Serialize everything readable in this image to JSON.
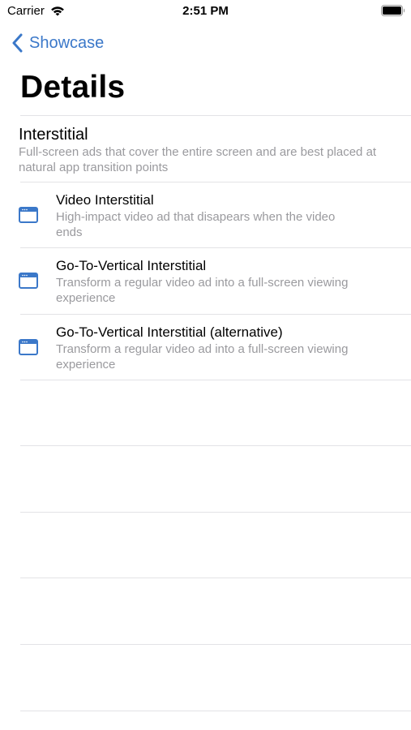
{
  "status_bar": {
    "carrier": "Carrier",
    "time": "2:51 PM",
    "wifi_icon": "wifi-icon",
    "battery_icon": "battery-icon"
  },
  "nav": {
    "back_label": "Showcase",
    "back_icon": "chevron-left-icon",
    "accent_color": "#3b78c9"
  },
  "page": {
    "title": "Details"
  },
  "section": {
    "title": "Interstitial",
    "description": "Full-screen ads that cover the entire screen and are best placed at natural app transition points"
  },
  "items": [
    {
      "title": "Video Interstitial",
      "description": "High-impact video ad that disapears when the video ends",
      "icon": "browser-window-icon"
    },
    {
      "title": "Go-To-Vertical Interstitial",
      "description": "Transform a regular video ad into a full-screen viewing experience",
      "icon": "browser-window-icon"
    },
    {
      "title": "Go-To-Vertical Interstitial (alternative)",
      "description": "Transform a regular video ad into a full-screen viewing experience",
      "icon": "browser-window-icon"
    }
  ]
}
